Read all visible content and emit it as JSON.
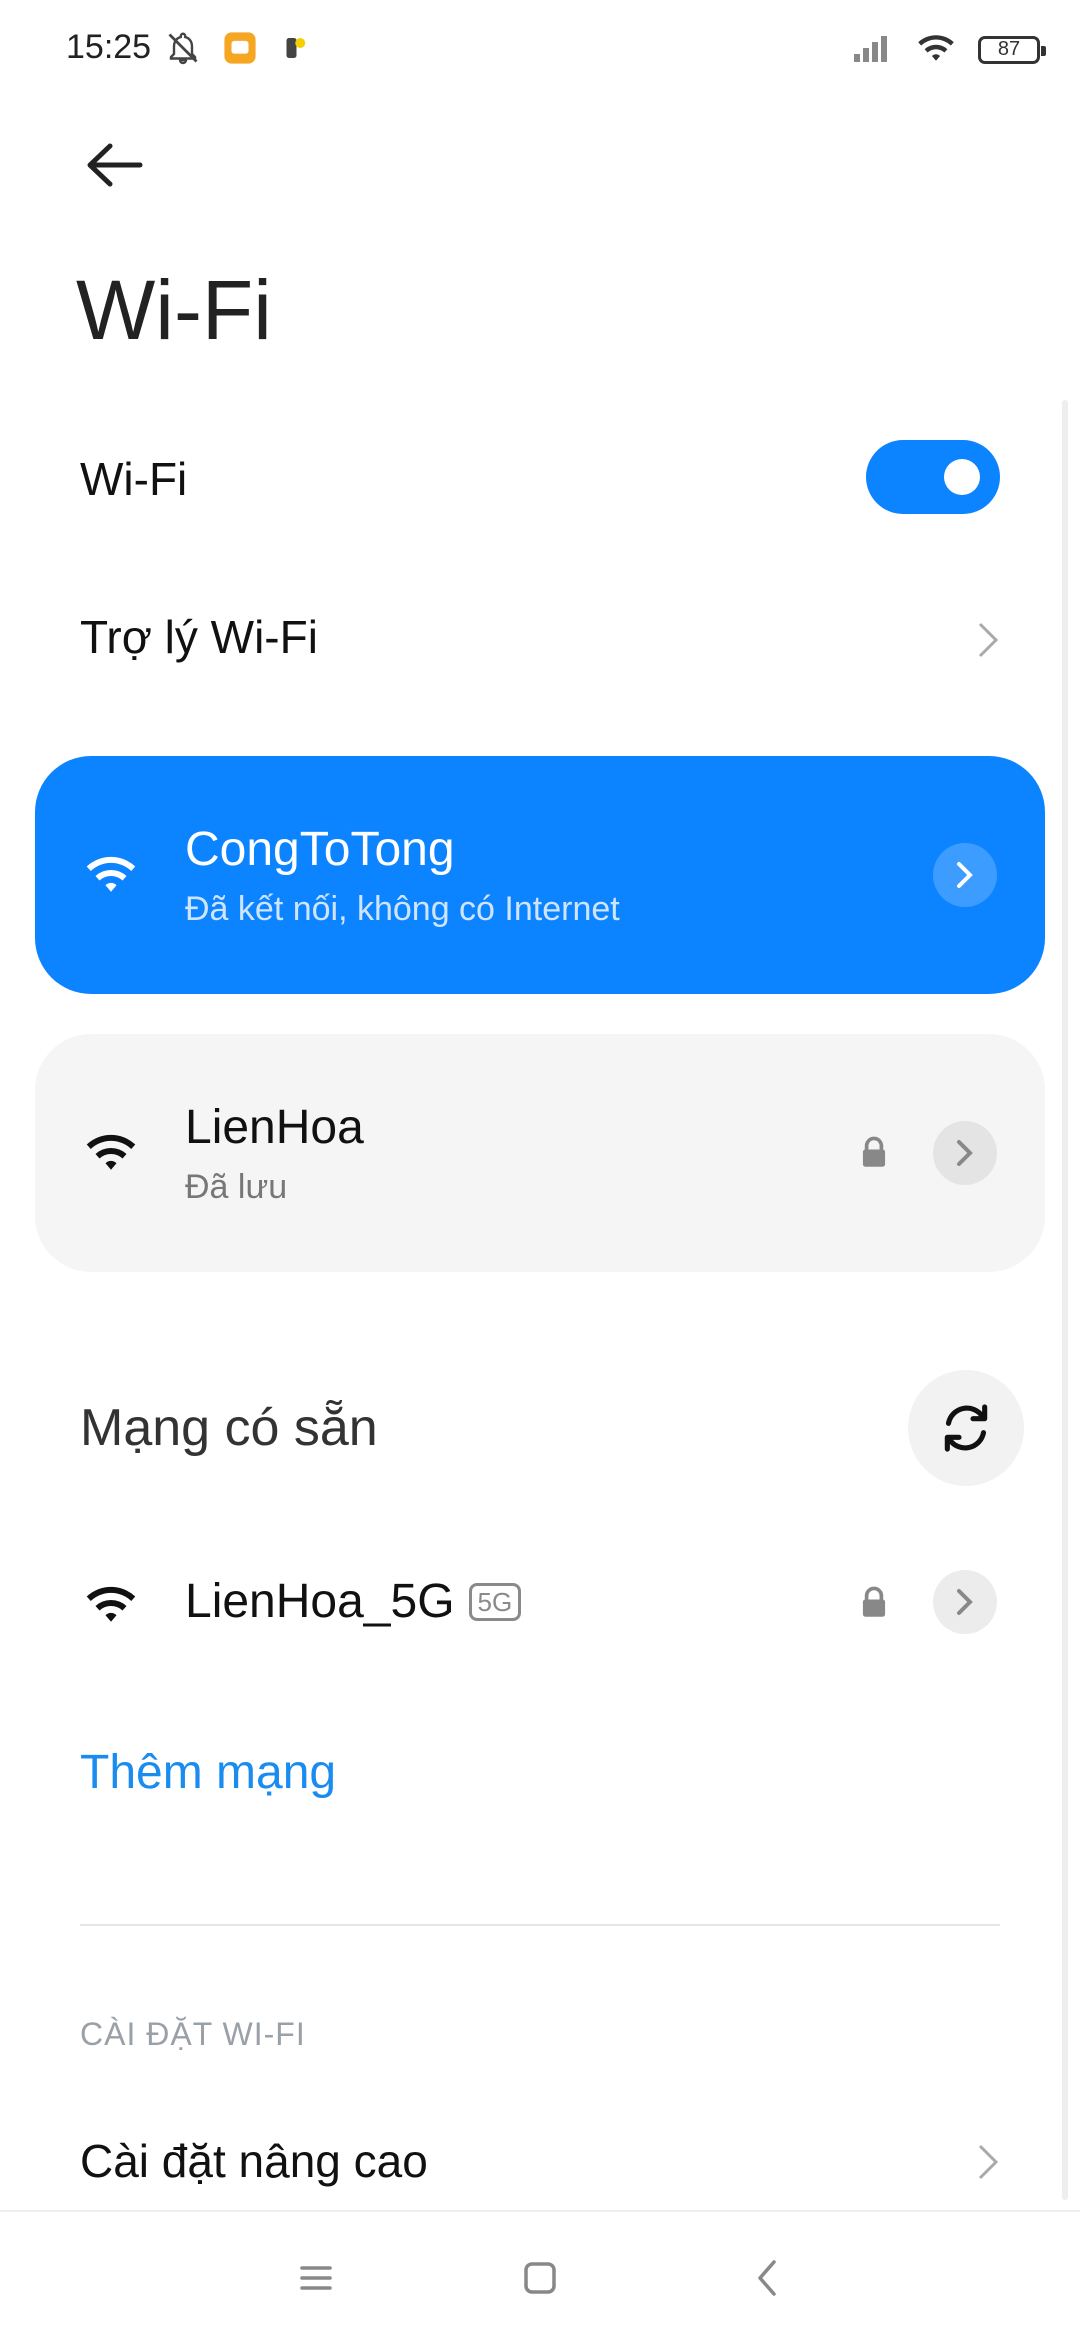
{
  "status_bar": {
    "time": "15:25",
    "battery": "87"
  },
  "header": {
    "title": "Wi-Fi"
  },
  "wifi_toggle": {
    "label": "Wi-Fi",
    "on": true
  },
  "assistant": {
    "label": "Trợ lý Wi-Fi"
  },
  "connected_network": {
    "name": "CongToTong",
    "status": "Đã kết nối, không có Internet"
  },
  "saved_network": {
    "name": "LienHoa",
    "status": "Đã lưu"
  },
  "available": {
    "title": "Mạng có sẵn",
    "networks": [
      {
        "name": "LienHoa_5G",
        "badge": "5G"
      }
    ]
  },
  "add_network": {
    "label": "Thêm mạng"
  },
  "settings": {
    "header": "CÀI ĐẶT WI-FI",
    "advanced": "Cài đặt nâng cao"
  },
  "colors": {
    "accent": "#0d84ff",
    "link": "#1a8cf0",
    "card_bg": "#f5f5f5"
  }
}
